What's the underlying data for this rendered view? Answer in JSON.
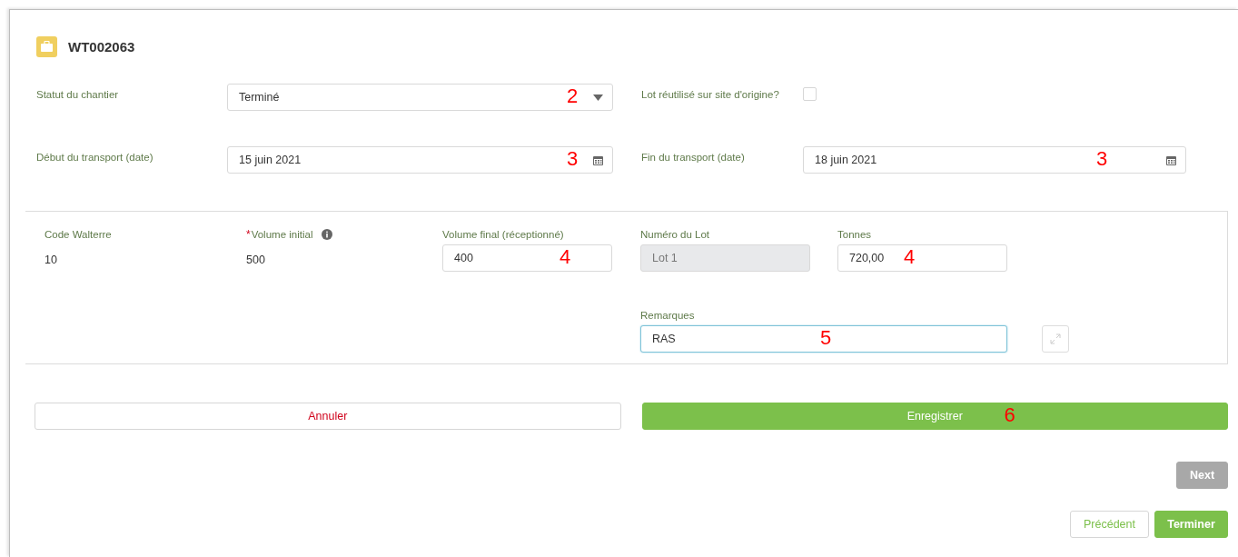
{
  "header": {
    "title": "WT002063"
  },
  "top_fields": [
    {
      "label": "Statut du chantier",
      "kind": "select",
      "value": "Terminé",
      "annotation": "2"
    },
    {
      "label": "Lot réutilisé sur site d'origine?",
      "kind": "checkbox",
      "checked": false
    },
    {
      "label": "Début du transport (date)",
      "kind": "date",
      "value": "15 juin 2021",
      "annotation": "3"
    },
    {
      "label": "Fin du transport (date)",
      "kind": "date",
      "value": "18 juin 2021",
      "annotation": "3"
    }
  ],
  "lot_panel": {
    "fields": [
      {
        "label": "Code Walterre",
        "kind": "text",
        "value": "10",
        "info": false
      },
      {
        "label": "Volume initial",
        "kind": "text",
        "value": "500",
        "required_mark": "*",
        "info": true
      },
      {
        "label": "Volume final (réceptionné)",
        "kind": "input",
        "value": "400",
        "disabled": false,
        "annotation": "4",
        "info": false
      },
      {
        "label": "Numéro du Lot",
        "kind": "input",
        "value": "Lot 1",
        "disabled": true,
        "info": false
      },
      {
        "label": "Tonnes",
        "kind": "input",
        "value": "720,00",
        "disabled": false,
        "annotation": "4",
        "info": false
      }
    ],
    "remark": {
      "label": "Remarques",
      "value": "RAS",
      "focused": true,
      "annotation": "5"
    }
  },
  "actions": [
    {
      "label": "Annuler",
      "kind": "cancel"
    },
    {
      "label": "Enregistrer",
      "kind": "primary",
      "annotation": "6"
    }
  ],
  "next": {
    "label": "Next",
    "disabled": true
  },
  "footer": [
    {
      "label": "Précédent",
      "kind": "secondary"
    },
    {
      "label": "Terminer",
      "kind": "primary"
    }
  ]
}
